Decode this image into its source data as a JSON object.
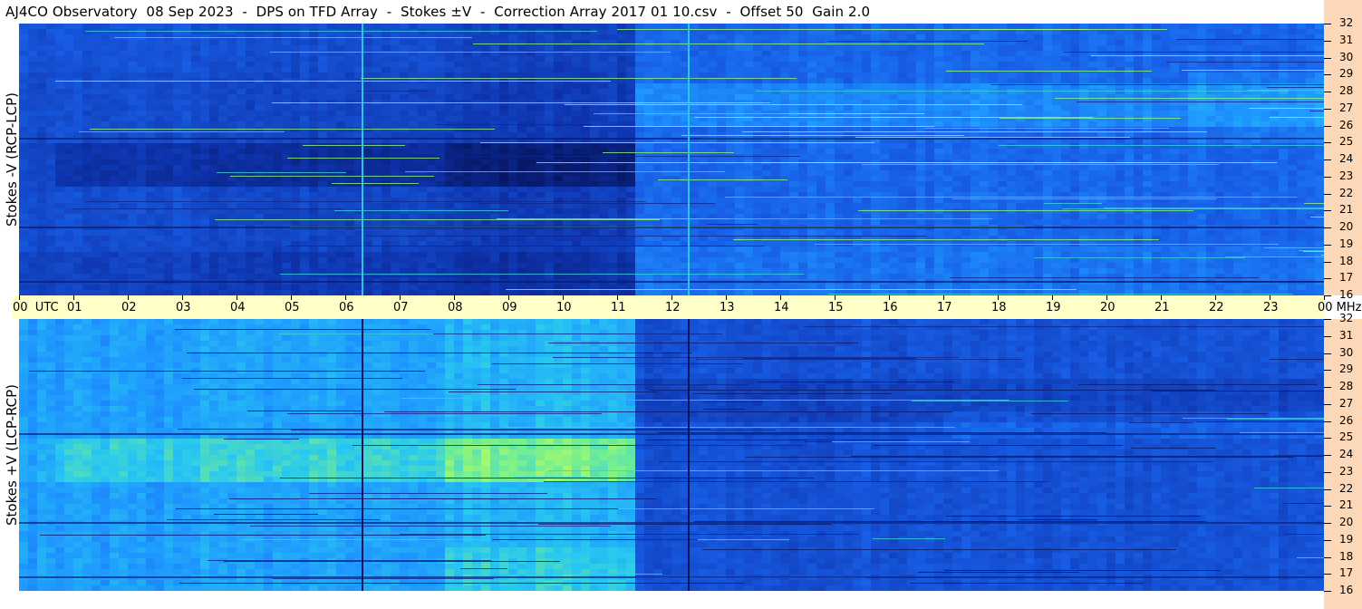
{
  "title": "AJ4CO Observatory  08 Sep 2023  -  DPS on TFD Array  -  Stokes ±V  -  Correction Array 2017 01 10.csv  -  Offset 50  Gain 2.0",
  "colors": {
    "time_bar": "#ffffc8",
    "freq_col": "#fcd8b8",
    "low": "#06145c",
    "mid": "#1e78ff",
    "high": "#b4ff64"
  },
  "chart_data": [
    {
      "type": "heatmap",
      "ylabel": "Stokes -V (RCP-LCP)",
      "y_unit": "MHz",
      "y_ticks": [
        "32",
        "31",
        "30",
        "29",
        "28",
        "27",
        "26",
        "25",
        "24",
        "23",
        "22",
        "21",
        "20",
        "19",
        "18",
        "17",
        "16"
      ],
      "ylim": [
        16,
        32
      ],
      "xlim": [
        0,
        24
      ],
      "vertical_lines_utc": [
        6.3,
        12.3
      ]
    },
    {
      "type": "heatmap",
      "ylabel": "Stokes +V (LCP-RCP)",
      "y_unit": "MHz",
      "y_ticks": [
        "32",
        "31",
        "30",
        "29",
        "28",
        "27",
        "26",
        "25",
        "24",
        "23",
        "22",
        "21",
        "20",
        "19",
        "18",
        "17",
        "16"
      ],
      "ylim": [
        16,
        32
      ],
      "xlim": [
        0,
        24
      ],
      "vertical_lines_utc": [
        6.3,
        12.3
      ]
    }
  ],
  "time_axis": {
    "unit_label": "UTC",
    "end_unit": "MHz",
    "ticks": [
      "00",
      "01",
      "02",
      "03",
      "04",
      "05",
      "06",
      "07",
      "08",
      "09",
      "10",
      "11",
      "12",
      "13",
      "14",
      "15",
      "16",
      "17",
      "18",
      "19",
      "20",
      "21",
      "22",
      "23",
      "00"
    ]
  }
}
